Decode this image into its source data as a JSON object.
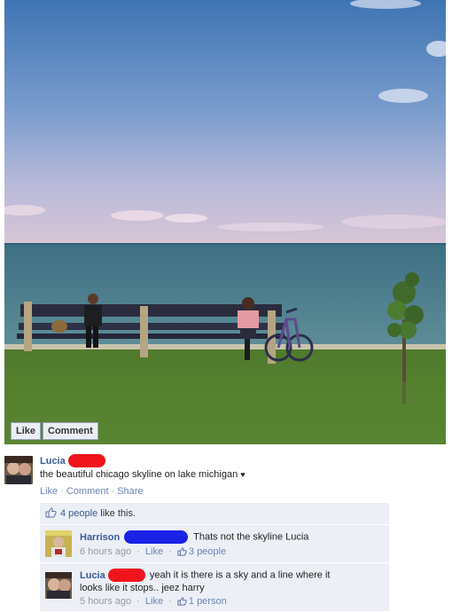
{
  "photo": {
    "like_label": "Like",
    "comment_label": "Comment"
  },
  "post": {
    "author": "Lucia",
    "text": "the beautiful chicago skyline on lake michigan",
    "heart": "♥",
    "actions": {
      "like": "Like",
      "comment": "Comment",
      "share": "Share",
      "sep": "·"
    }
  },
  "likes": {
    "count_link": "4 people",
    "suffix": "like this."
  },
  "comments": [
    {
      "author": "Harrison",
      "text": "Thats not the skyline Lucia",
      "time": "6 hours ago",
      "like": "Like",
      "likes": "3 people",
      "redaction_color": "#1a22e6"
    },
    {
      "author": "Lucia",
      "text_line1": "yeah it is there is a sky and a line where it",
      "text_line2": "looks like it stops.. jeez harry",
      "time": "5 hours ago",
      "like": "Like",
      "likes": "1 person",
      "redaction_color": "#f0141c"
    }
  ],
  "colors": {
    "link": "#3b5998",
    "ufi_bg": "#eceff5",
    "redaction_red": "#f0141c",
    "redaction_blue": "#1a22e6"
  }
}
